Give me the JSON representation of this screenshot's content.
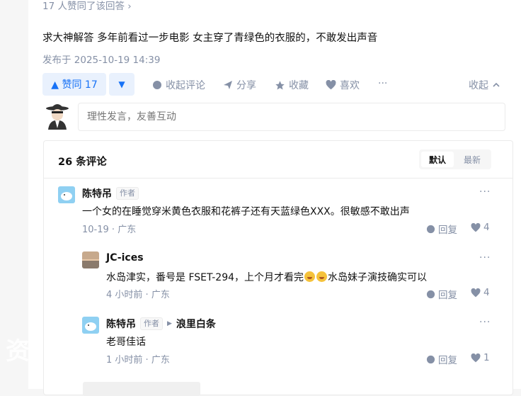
{
  "answer": {
    "likes_line": "17 人赞同了该回答 ›",
    "text": "求大神解答 多年前看过一步电影 女主穿了青绿色的衣服的，不敢发出声音",
    "published": "发布于 2025-10-19 14:39"
  },
  "actions": {
    "vote_label": "▲ 赞同 17",
    "down_label": "▼",
    "comment": "收起评论",
    "share": "分享",
    "favorite": "收藏",
    "like": "喜欢",
    "more": "···",
    "collapse": "收起"
  },
  "comment_input": {
    "placeholder": "理性发言，友善互动"
  },
  "comments_panel": {
    "count_label": "26 条评论",
    "sort_default": "默认",
    "sort_latest": "最新"
  },
  "comments": [
    {
      "author": "陈特吊",
      "tag": "作者",
      "text": "一个女的在睡觉穿米黄色衣服和花裤子还有天蓝绿色ⅩⅩⅩ。很敏感不敢出声",
      "time": "10-19",
      "location": "广东",
      "reply_label": "回复",
      "likes": "4"
    },
    {
      "author": "JC-ices",
      "text_before": "水岛津实，番号是 FSET-294，上个月才看完",
      "text_after": "水岛妹子演技确实可以",
      "time": "4 小时前",
      "location": "广东",
      "reply_label": "回复",
      "likes": "4"
    },
    {
      "author": "陈特吊",
      "tag": "作者",
      "reply_to": "浪里白条",
      "text": "老哥佳话",
      "time": "1 小时前",
      "location": "广东",
      "reply_label": "回复",
      "likes": "1"
    }
  ],
  "watermark": "资",
  "colors": {
    "accent": "#1772f6",
    "accent_bg": "#e9f1fd",
    "muted": "#8590a6",
    "text": "#121212",
    "border": "#ebebeb"
  }
}
